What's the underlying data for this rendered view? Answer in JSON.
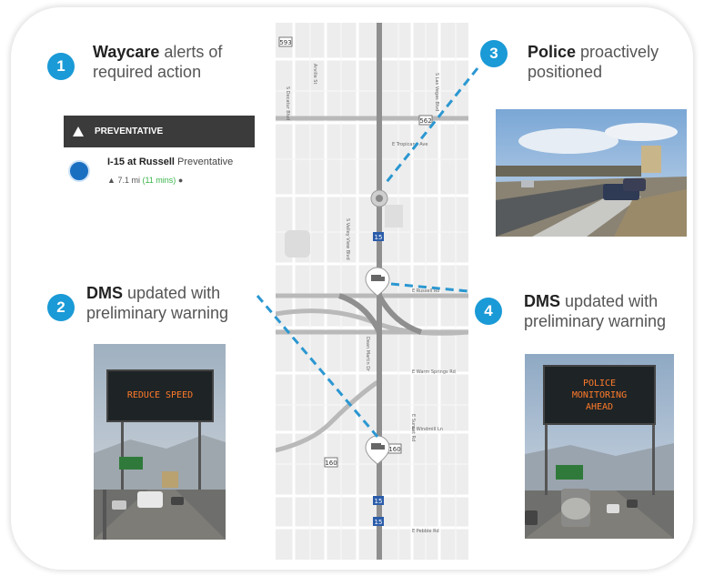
{
  "steps": [
    {
      "num": "1",
      "bold": "Waycare",
      "rest1": " alerts of",
      "rest2": "required action"
    },
    {
      "num": "2",
      "bold": "DMS",
      "rest1": " updated with",
      "rest2": "preliminary warning"
    },
    {
      "num": "3",
      "bold": "Police",
      "rest1": " proactively",
      "rest2": "positioned"
    },
    {
      "num": "4",
      "bold": "DMS",
      "rest1": " updated with",
      "rest2": "preliminary warning"
    }
  ],
  "alert": {
    "header": "PREVENTATIVE",
    "location": "I-15 at Russell",
    "type": " Preventative",
    "distance": "7.1 mi",
    "eta": "(11 mins)"
  },
  "signs": {
    "sign2": "REDUCE SPEED",
    "sign4_line1": "POLICE",
    "sign4_line2": "MONITORING",
    "sign4_line3": "AHEAD"
  },
  "map_labels": {
    "hwy_top": "593",
    "hwy_mid": "562",
    "hwy_15a": "15",
    "hwy_15b": "15",
    "hwy_15c": "15",
    "hwy_160a": "160",
    "hwy_160b": "160",
    "st_decatur": "S Decatur Blvd",
    "st_arville": "Arville St",
    "st_valley": "S Valley View Blvd",
    "st_dean": "Dean Martin Dr",
    "st_warm": "E Warm Springs Rd",
    "st_windmill": "E Windmill Ln",
    "st_russell": "E Russell Rd",
    "st_pebble": "E Pebble Rd",
    "st_tropicana": "E Tropicana Ave",
    "st_las_vegas": "S Las Vegas Blvd",
    "st_sunset": "E Sunset Rd"
  },
  "colors": {
    "accent": "#1a9ad6",
    "dashed_line": "#2b97d1",
    "sign_text": "#ff7a2a",
    "eta_green": "#3bb54a"
  },
  "icons": [
    "warning-icon",
    "police-pin-icon",
    "car-icon",
    "clock-icon",
    "map-pin-icon"
  ]
}
